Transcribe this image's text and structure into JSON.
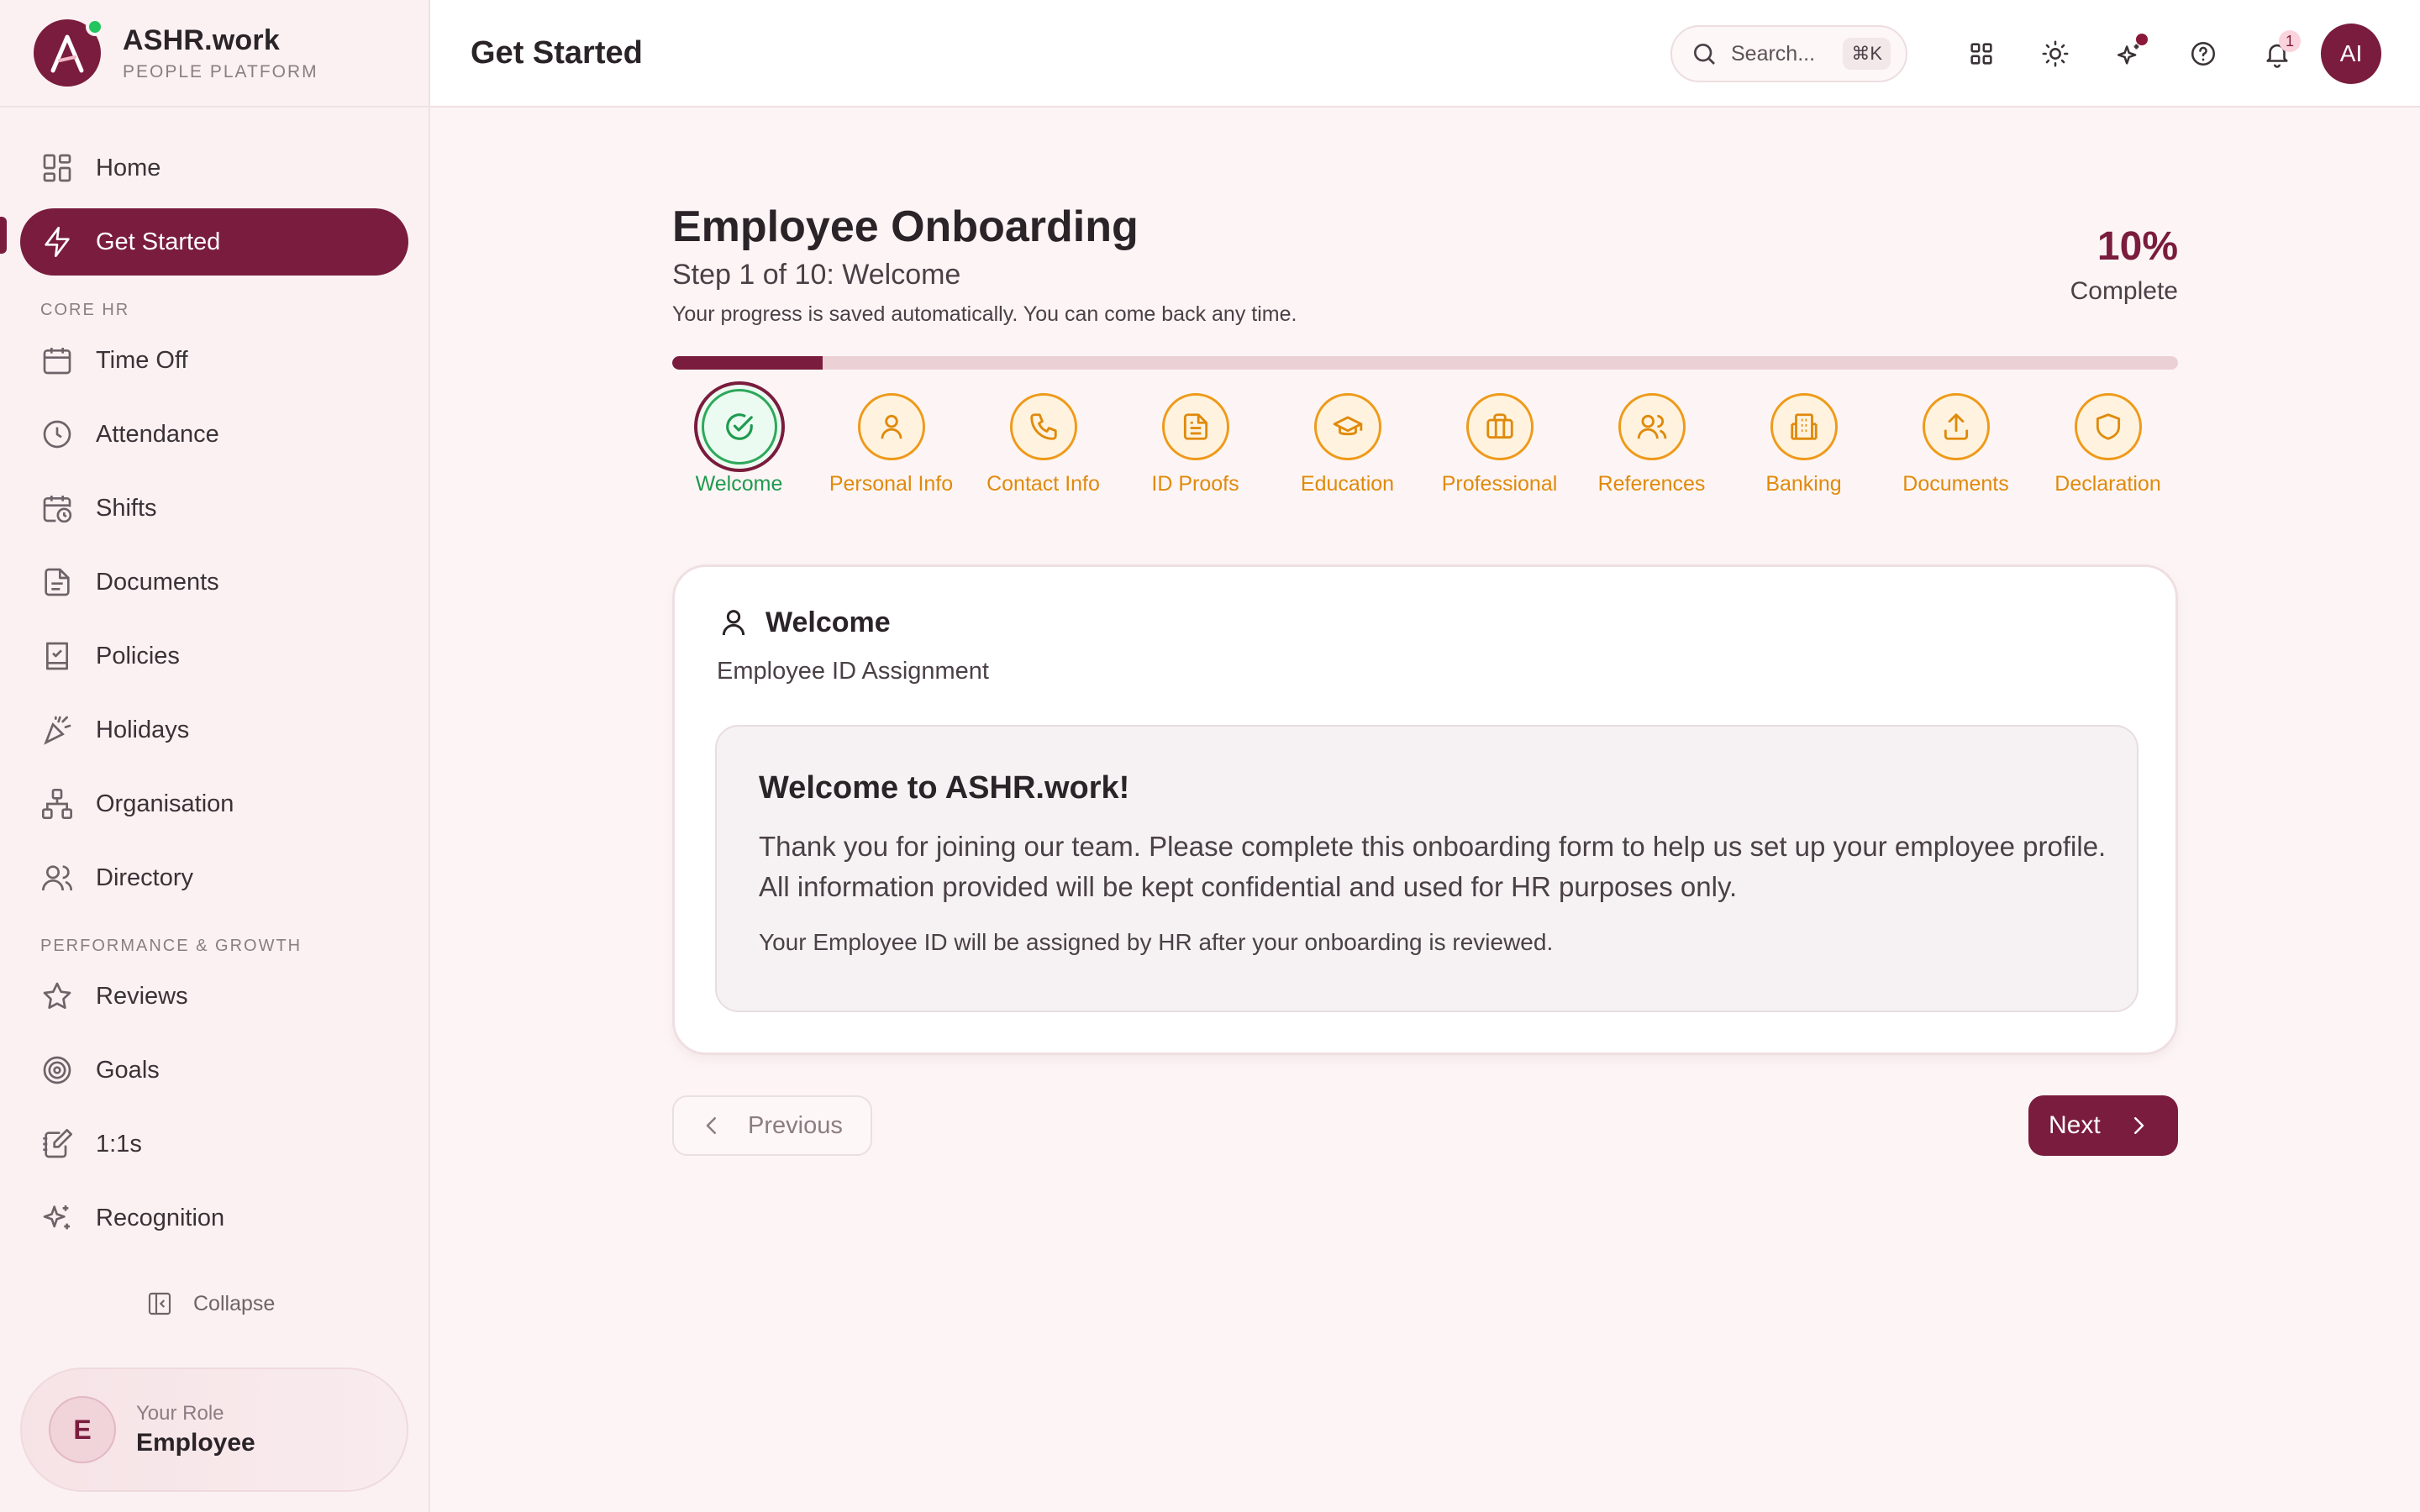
{
  "brand": {
    "name": "ASHR.work",
    "subtitle": "PEOPLE PLATFORM"
  },
  "sidebar": {
    "items": [
      {
        "label": "Home",
        "icon": "grid-icon"
      },
      {
        "label": "Get Started",
        "icon": "zap-icon",
        "active": true
      }
    ],
    "core_hr": {
      "heading": "CORE HR",
      "items": [
        {
          "label": "Time Off",
          "icon": "calendar-icon"
        },
        {
          "label": "Attendance",
          "icon": "clock-icon"
        },
        {
          "label": "Shifts",
          "icon": "calendar-clock-icon"
        },
        {
          "label": "Documents",
          "icon": "file-icon"
        },
        {
          "label": "Policies",
          "icon": "book-check-icon"
        },
        {
          "label": "Holidays",
          "icon": "party-icon"
        },
        {
          "label": "Organisation",
          "icon": "network-icon"
        },
        {
          "label": "Directory",
          "icon": "users-icon"
        }
      ]
    },
    "performance": {
      "heading": "PERFORMANCE & GROWTH",
      "items": [
        {
          "label": "Reviews",
          "icon": "star-icon"
        },
        {
          "label": "Goals",
          "icon": "target-icon"
        },
        {
          "label": "1:1s",
          "icon": "notebook-pen-icon"
        },
        {
          "label": "Recognition",
          "icon": "sparkles-icon"
        }
      ]
    },
    "collapse_label": "Collapse",
    "role": {
      "initial": "E",
      "label": "Your Role",
      "value": "Employee"
    }
  },
  "header": {
    "title": "Get Started",
    "search": {
      "placeholder": "Search...",
      "shortcut": "⌘K"
    },
    "notification_count": "1",
    "user_initials": "AI"
  },
  "onboarding": {
    "title": "Employee Onboarding",
    "step_label": "Step 1 of 10: Welcome",
    "saved_note": "Your progress is saved automatically. You can come back any time.",
    "percent": "10%",
    "percent_label": "Complete",
    "progress_fraction": 0.1,
    "steps": [
      {
        "label": "Welcome",
        "icon": "check-circle-icon",
        "current": true
      },
      {
        "label": "Personal Info",
        "icon": "user-icon"
      },
      {
        "label": "Contact Info",
        "icon": "phone-icon"
      },
      {
        "label": "ID Proofs",
        "icon": "file-text-icon"
      },
      {
        "label": "Education",
        "icon": "graduation-cap-icon"
      },
      {
        "label": "Professional",
        "icon": "briefcase-icon"
      },
      {
        "label": "References",
        "icon": "users-icon"
      },
      {
        "label": "Banking",
        "icon": "building-icon"
      },
      {
        "label": "Documents",
        "icon": "upload-icon"
      },
      {
        "label": "Declaration",
        "icon": "shield-icon"
      }
    ]
  },
  "card": {
    "title": "Welcome",
    "subtitle": "Employee ID Assignment",
    "welcome_title": "Welcome to ASHR.work!",
    "welcome_body": "Thank you for joining our team. Please complete this onboarding form to help us set up your employee profile. All information provided will be kept confidential and used for HR purposes only.",
    "welcome_note": "Your Employee ID will be assigned by HR after your onboarding is reviewed."
  },
  "nav_buttons": {
    "previous": "Previous",
    "next": "Next"
  },
  "colors": {
    "brand": "#7a1c3d",
    "pending_step": "#e08a0b",
    "current_step": "#1f9a4f",
    "online_dot": "#22c55e"
  }
}
